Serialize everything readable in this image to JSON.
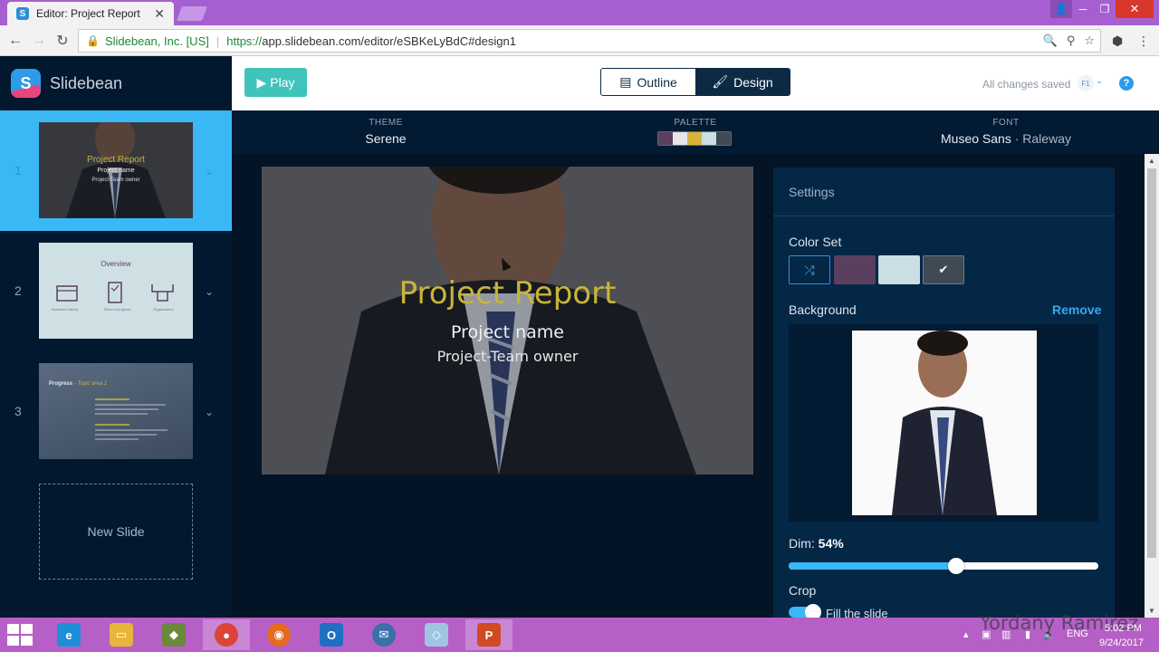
{
  "browser": {
    "tab_title": "Editor: Project Report",
    "tab_favicon": "S",
    "site_identity": "Slidebean, Inc. [US]",
    "url_scheme": "https://",
    "url_rest": "app.slidebean.com/editor/eSBKeLyBdC#design1"
  },
  "app": {
    "brand_name": "Slidebean",
    "brand_logo_letter": "S",
    "play_label": "Play",
    "outline_label": "Outline",
    "design_label": "Design",
    "saved_status": "All changes saved",
    "user_initials": "F1",
    "help_label": "?",
    "accent": "#3ab8f5"
  },
  "theme_bar": {
    "theme_label": "THEME",
    "theme_value": "Serene",
    "palette_label": "PALETTE",
    "palette_colors": [
      "#5a3f5e",
      "#e6e6e6",
      "#d9b33b",
      "#c9dfe3",
      "#3f4a55"
    ],
    "font_label": "FONT",
    "font_primary": "Museo Sans",
    "font_secondary": "· Raleway"
  },
  "slides": [
    {
      "number": "1",
      "title": "Project Report",
      "line1": "Project name",
      "line2": "Project-Team owner"
    },
    {
      "number": "2",
      "title": "Overview",
      "captions": [
        "Business history",
        "Recent progress",
        "Organization"
      ]
    },
    {
      "number": "3",
      "title": "Progress",
      "subtitle": "- Topic area 1"
    }
  ],
  "new_slide_label": "New Slide",
  "main_slide": {
    "title": "Project Report",
    "line1": "Project name",
    "line2": "Project-Team  owner",
    "title_color": "#c8b53a"
  },
  "settings": {
    "header": "Settings",
    "color_set_label": "Color Set",
    "color_swatches": [
      "#1f7dc9",
      "#5a3f5e",
      "#c9dfe3",
      "#3f4a55"
    ],
    "background_label": "Background",
    "remove_label": "Remove",
    "dim_label": "Dim:",
    "dim_value": "54%",
    "dim_fraction": 0.54,
    "crop_label": "Crop",
    "fill_label": "Fill the slide"
  },
  "taskbar": {
    "lang": "ENG",
    "time": "5:02 PM",
    "date": "9/24/2017",
    "watermark": "Yordany Ramirez"
  }
}
